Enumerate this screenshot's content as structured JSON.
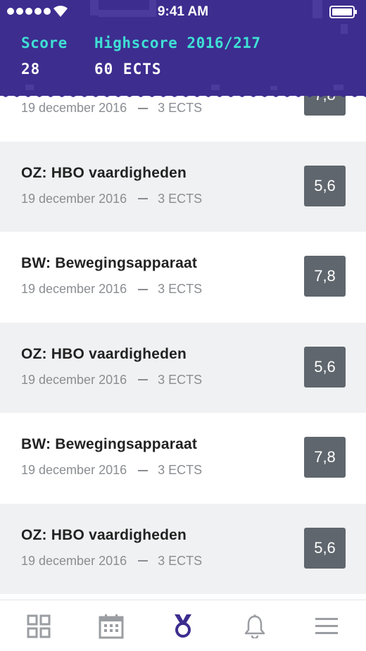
{
  "status_bar": {
    "time": "9:41 AM"
  },
  "header": {
    "score_label": "Score",
    "score_value": "28",
    "highscore_label": "Highscore 2016/217",
    "highscore_value": "60 ECTS"
  },
  "courses": [
    {
      "name": "",
      "date": "19 december 2016",
      "ects": "3 ECTS",
      "grade": "7,8"
    },
    {
      "name": "OZ: HBO vaardigheden",
      "date": "19 december 2016",
      "ects": "3 ECTS",
      "grade": "5,6"
    },
    {
      "name": "BW: Bewegingsapparaat",
      "date": "19 december 2016",
      "ects": "3 ECTS",
      "grade": "7,8"
    },
    {
      "name": "OZ: HBO vaardigheden",
      "date": "19 december 2016",
      "ects": "3 ECTS",
      "grade": "5,6"
    },
    {
      "name": "BW: Bewegingsapparaat",
      "date": "19 december 2016",
      "ects": "3 ECTS",
      "grade": "7,8"
    },
    {
      "name": "OZ: HBO vaardigheden",
      "date": "19 december 2016",
      "ects": "3 ECTS",
      "grade": "5,6"
    }
  ],
  "tabbar": {
    "items": [
      {
        "icon": "grid-icon",
        "active": false
      },
      {
        "icon": "calendar-icon",
        "active": false
      },
      {
        "icon": "medal-icon",
        "active": true
      },
      {
        "icon": "bell-icon",
        "active": false
      },
      {
        "icon": "menu-icon",
        "active": false
      }
    ]
  },
  "colors": {
    "header_bg": "#3d2d8f",
    "score_label": "#3fe0d4",
    "grade_bg": "#5f666d",
    "active_tab": "#3d2d8f",
    "inactive_tab": "#9a9da1"
  }
}
